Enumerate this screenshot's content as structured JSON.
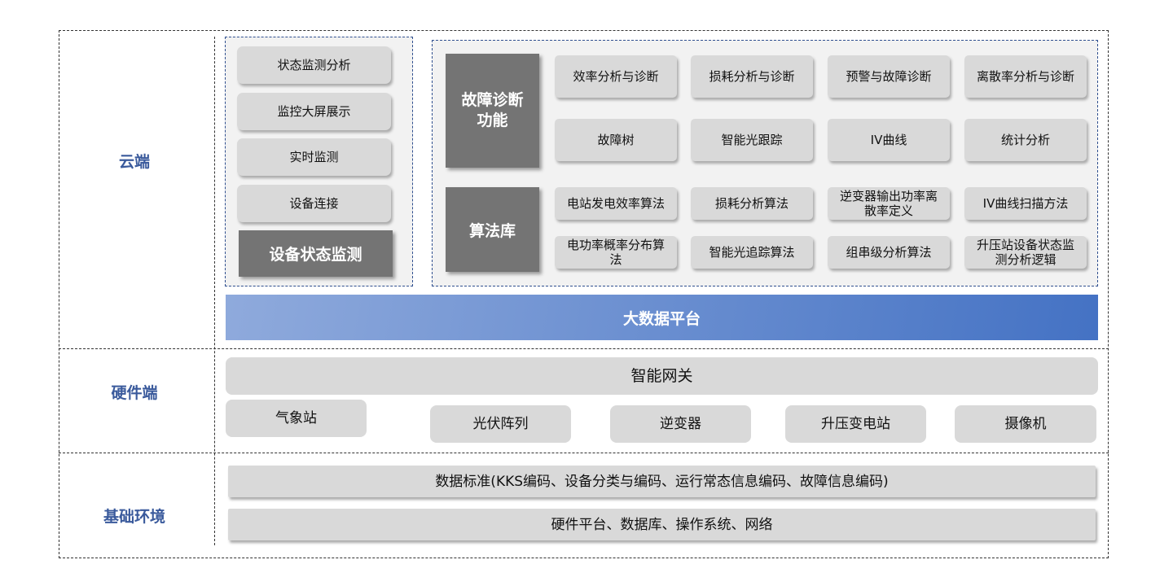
{
  "layers": {
    "cloud": "云端",
    "hardware": "硬件端",
    "base": "基础环境"
  },
  "device_monitoring": {
    "items": [
      "状态监测分析",
      "监控大屏展示",
      "实时监测",
      "设备连接"
    ],
    "title": "设备状态监测"
  },
  "fault_diagnosis": {
    "title": "故障诊断功能",
    "items": [
      "效率分析与诊断",
      "损耗分析与诊断",
      "预警与故障诊断",
      "离散率分析与诊断",
      "故障树",
      "智能光跟踪",
      "IV曲线",
      "统计分析"
    ]
  },
  "algorithm_library": {
    "title": "算法库",
    "items": [
      "电站发电效率算法",
      "损耗分析算法",
      "逆变器输出功率离散率定义",
      "IV曲线扫描方法",
      "电功率概率分布算法",
      "智能光追踪算法",
      "组串级分析算法",
      "升压站设备状态监测分析逻辑"
    ]
  },
  "big_data_platform": "大数据平台",
  "gateway": "智能网关",
  "devices": [
    "气象站",
    "光伏阵列",
    "逆变器",
    "升压变电站",
    "摄像机"
  ],
  "base_items": [
    "数据标准(KKS编码、设备分类与编码、运行常态信息编码、故障信息编码)",
    "硬件平台、数据库、操作系统、网络"
  ],
  "colors": {
    "label": "#3a5a9c",
    "dark_box": "#747474",
    "button": "#d9d9d9",
    "gradient_start": "#8faadc",
    "gradient_end": "#4472c4"
  }
}
